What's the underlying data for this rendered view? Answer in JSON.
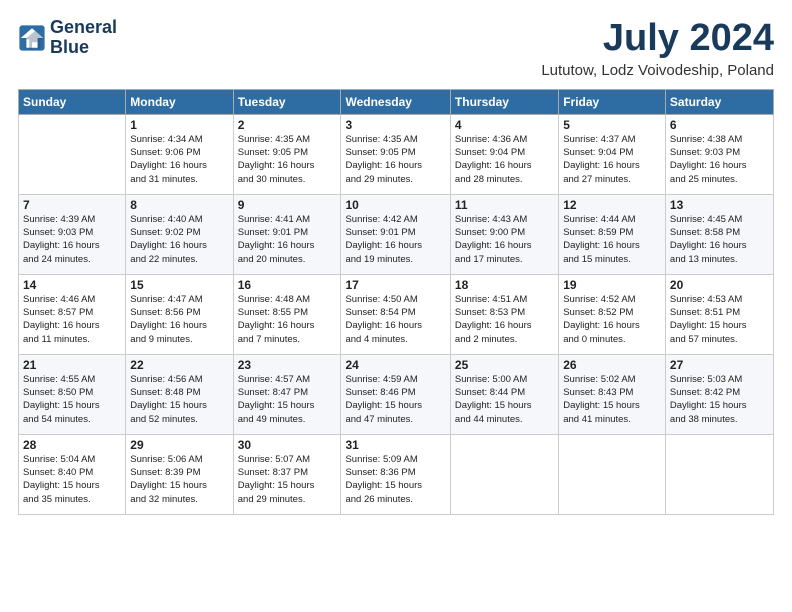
{
  "logo": {
    "line1": "General",
    "line2": "Blue"
  },
  "title": "July 2024",
  "location": "Lututow, Lodz Voivodeship, Poland",
  "headers": [
    "Sunday",
    "Monday",
    "Tuesday",
    "Wednesday",
    "Thursday",
    "Friday",
    "Saturday"
  ],
  "weeks": [
    [
      {
        "day": "",
        "info": ""
      },
      {
        "day": "1",
        "info": "Sunrise: 4:34 AM\nSunset: 9:06 PM\nDaylight: 16 hours\nand 31 minutes."
      },
      {
        "day": "2",
        "info": "Sunrise: 4:35 AM\nSunset: 9:05 PM\nDaylight: 16 hours\nand 30 minutes."
      },
      {
        "day": "3",
        "info": "Sunrise: 4:35 AM\nSunset: 9:05 PM\nDaylight: 16 hours\nand 29 minutes."
      },
      {
        "day": "4",
        "info": "Sunrise: 4:36 AM\nSunset: 9:04 PM\nDaylight: 16 hours\nand 28 minutes."
      },
      {
        "day": "5",
        "info": "Sunrise: 4:37 AM\nSunset: 9:04 PM\nDaylight: 16 hours\nand 27 minutes."
      },
      {
        "day": "6",
        "info": "Sunrise: 4:38 AM\nSunset: 9:03 PM\nDaylight: 16 hours\nand 25 minutes."
      }
    ],
    [
      {
        "day": "7",
        "info": "Sunrise: 4:39 AM\nSunset: 9:03 PM\nDaylight: 16 hours\nand 24 minutes."
      },
      {
        "day": "8",
        "info": "Sunrise: 4:40 AM\nSunset: 9:02 PM\nDaylight: 16 hours\nand 22 minutes."
      },
      {
        "day": "9",
        "info": "Sunrise: 4:41 AM\nSunset: 9:01 PM\nDaylight: 16 hours\nand 20 minutes."
      },
      {
        "day": "10",
        "info": "Sunrise: 4:42 AM\nSunset: 9:01 PM\nDaylight: 16 hours\nand 19 minutes."
      },
      {
        "day": "11",
        "info": "Sunrise: 4:43 AM\nSunset: 9:00 PM\nDaylight: 16 hours\nand 17 minutes."
      },
      {
        "day": "12",
        "info": "Sunrise: 4:44 AM\nSunset: 8:59 PM\nDaylight: 16 hours\nand 15 minutes."
      },
      {
        "day": "13",
        "info": "Sunrise: 4:45 AM\nSunset: 8:58 PM\nDaylight: 16 hours\nand 13 minutes."
      }
    ],
    [
      {
        "day": "14",
        "info": "Sunrise: 4:46 AM\nSunset: 8:57 PM\nDaylight: 16 hours\nand 11 minutes."
      },
      {
        "day": "15",
        "info": "Sunrise: 4:47 AM\nSunset: 8:56 PM\nDaylight: 16 hours\nand 9 minutes."
      },
      {
        "day": "16",
        "info": "Sunrise: 4:48 AM\nSunset: 8:55 PM\nDaylight: 16 hours\nand 7 minutes."
      },
      {
        "day": "17",
        "info": "Sunrise: 4:50 AM\nSunset: 8:54 PM\nDaylight: 16 hours\nand 4 minutes."
      },
      {
        "day": "18",
        "info": "Sunrise: 4:51 AM\nSunset: 8:53 PM\nDaylight: 16 hours\nand 2 minutes."
      },
      {
        "day": "19",
        "info": "Sunrise: 4:52 AM\nSunset: 8:52 PM\nDaylight: 16 hours\nand 0 minutes."
      },
      {
        "day": "20",
        "info": "Sunrise: 4:53 AM\nSunset: 8:51 PM\nDaylight: 15 hours\nand 57 minutes."
      }
    ],
    [
      {
        "day": "21",
        "info": "Sunrise: 4:55 AM\nSunset: 8:50 PM\nDaylight: 15 hours\nand 54 minutes."
      },
      {
        "day": "22",
        "info": "Sunrise: 4:56 AM\nSunset: 8:48 PM\nDaylight: 15 hours\nand 52 minutes."
      },
      {
        "day": "23",
        "info": "Sunrise: 4:57 AM\nSunset: 8:47 PM\nDaylight: 15 hours\nand 49 minutes."
      },
      {
        "day": "24",
        "info": "Sunrise: 4:59 AM\nSunset: 8:46 PM\nDaylight: 15 hours\nand 47 minutes."
      },
      {
        "day": "25",
        "info": "Sunrise: 5:00 AM\nSunset: 8:44 PM\nDaylight: 15 hours\nand 44 minutes."
      },
      {
        "day": "26",
        "info": "Sunrise: 5:02 AM\nSunset: 8:43 PM\nDaylight: 15 hours\nand 41 minutes."
      },
      {
        "day": "27",
        "info": "Sunrise: 5:03 AM\nSunset: 8:42 PM\nDaylight: 15 hours\nand 38 minutes."
      }
    ],
    [
      {
        "day": "28",
        "info": "Sunrise: 5:04 AM\nSunset: 8:40 PM\nDaylight: 15 hours\nand 35 minutes."
      },
      {
        "day": "29",
        "info": "Sunrise: 5:06 AM\nSunset: 8:39 PM\nDaylight: 15 hours\nand 32 minutes."
      },
      {
        "day": "30",
        "info": "Sunrise: 5:07 AM\nSunset: 8:37 PM\nDaylight: 15 hours\nand 29 minutes."
      },
      {
        "day": "31",
        "info": "Sunrise: 5:09 AM\nSunset: 8:36 PM\nDaylight: 15 hours\nand 26 minutes."
      },
      {
        "day": "",
        "info": ""
      },
      {
        "day": "",
        "info": ""
      },
      {
        "day": "",
        "info": ""
      }
    ]
  ]
}
